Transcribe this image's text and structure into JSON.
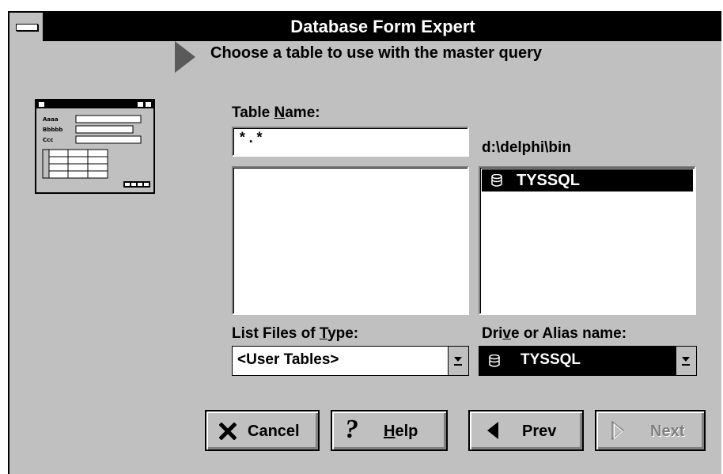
{
  "window": {
    "title": "Database Form Expert"
  },
  "prompt": "Choose a table to use with the master query",
  "table_name": {
    "label_pre": "Table ",
    "label_u": "N",
    "label_post": "ame:",
    "value": "*.*"
  },
  "directory": "d:\\delphi\\bin",
  "directory_list": {
    "items": [
      "TYSSQL"
    ],
    "selected": "TYSSQL"
  },
  "file_type": {
    "label_pre": "List Files of ",
    "label_u": "T",
    "label_post": "ype:",
    "value": "<User Tables>"
  },
  "drive": {
    "label_pre": "Dri",
    "label_u": "v",
    "label_post": "e or Alias name:",
    "value": "TYSSQL"
  },
  "buttons": {
    "cancel": "Cancel",
    "help_u": "H",
    "help_rest": "elp",
    "prev": "Prev",
    "next": "Next"
  },
  "illustration": {
    "row_labels": [
      "Aaaa",
      "Bbbbb",
      "Ccc"
    ]
  }
}
